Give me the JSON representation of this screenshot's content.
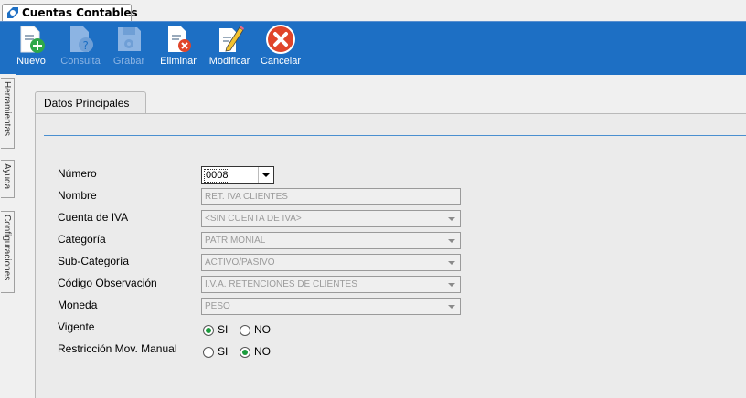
{
  "window_tab": {
    "title": "Cuentas Contables"
  },
  "toolbar": {
    "nuevo": "Nuevo",
    "consulta": "Consulta",
    "grabar": "Grabar",
    "eliminar": "Eliminar",
    "modificar": "Modificar",
    "cancelar": "Cancelar"
  },
  "side_tabs": {
    "herramientas": "Herramientas",
    "ayuda": "Ayuda",
    "configuraciones": "Configuraciones"
  },
  "panel": {
    "tab_label": "Datos Principales"
  },
  "form": {
    "numero": {
      "label": "Número",
      "value": "0008"
    },
    "nombre": {
      "label": "Nombre",
      "value": "RET. IVA CLIENTES"
    },
    "cuenta_iva": {
      "label": "Cuenta de IVA",
      "value": "<SIN CUENTA DE IVA>"
    },
    "categoria": {
      "label": "Categoría",
      "value": "PATRIMONIAL"
    },
    "sub_categoria": {
      "label": "Sub-Categoría",
      "value": "ACTIVO/PASIVO"
    },
    "codigo_observacion": {
      "label": "Código Observación",
      "value": "I.V.A. RETENCIONES DE CLIENTES"
    },
    "moneda": {
      "label": "Moneda",
      "value": "PESO"
    },
    "vigente": {
      "label": "Vigente",
      "si": "SI",
      "no": "NO",
      "selected": "SI"
    },
    "restriccion": {
      "label": "Restricción Mov. Manual",
      "si": "SI",
      "no": "NO",
      "selected": "NO"
    }
  },
  "colors": {
    "toolbar": "#1d6fc4",
    "accent_line": "#4a8fd0",
    "radio_selected": "#1a9b3c",
    "cancel_icon": "#e0452a"
  }
}
